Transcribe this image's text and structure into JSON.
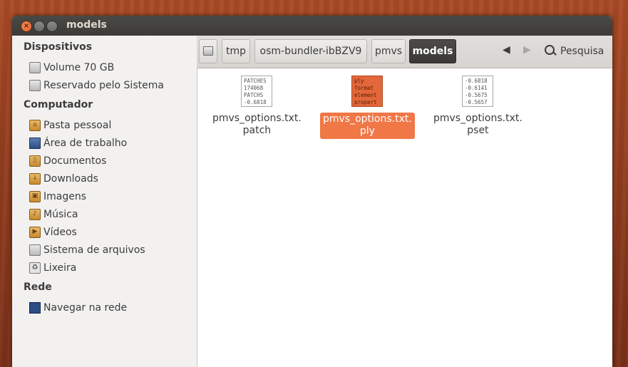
{
  "window": {
    "title": "models"
  },
  "sidebar": {
    "sections": [
      {
        "heading": "Dispositivos",
        "items": [
          {
            "label": "Volume 70 GB",
            "icon": "drive-icon"
          },
          {
            "label": "Reservado pelo Sistema",
            "icon": "drive-icon"
          }
        ]
      },
      {
        "heading": "Computador",
        "items": [
          {
            "label": "Pasta pessoal",
            "icon": "home-folder-icon"
          },
          {
            "label": "Área de trabalho",
            "icon": "desktop-icon"
          },
          {
            "label": "Documentos",
            "icon": "documents-folder-icon"
          },
          {
            "label": "Downloads",
            "icon": "downloads-folder-icon"
          },
          {
            "label": "Imagens",
            "icon": "pictures-folder-icon"
          },
          {
            "label": "Música",
            "icon": "music-folder-icon"
          },
          {
            "label": "Vídeos",
            "icon": "videos-folder-icon"
          },
          {
            "label": "Sistema de arquivos",
            "icon": "drive-icon"
          },
          {
            "label": "Lixeira",
            "icon": "trash-icon"
          }
        ]
      },
      {
        "heading": "Rede",
        "items": [
          {
            "label": "Navegar na rede",
            "icon": "network-icon"
          }
        ]
      }
    ]
  },
  "toolbar": {
    "breadcrumbs": [
      "tmp",
      "osm-bundler-ibBZV9",
      "pmvs",
      "models"
    ],
    "search_label": "Pesquisa"
  },
  "files": [
    {
      "name_line1": "pmvs_options.txt.",
      "name_line2": "patch",
      "preview": "PATCHES\n174068\nPATCHS\n-0.6818",
      "selected": false
    },
    {
      "name_line1": "pmvs_options.txt.",
      "name_line2": "ply",
      "preview": "ply\nformat\nelement\npropert",
      "selected": true
    },
    {
      "name_line1": "pmvs_options.txt.",
      "name_line2": "pset",
      "preview": "-0.6818\n-0.6141\n-0.5675\n-0.5657",
      "selected": false
    }
  ],
  "colors": {
    "selection": "#f07746",
    "titlebar": "#3c3b37"
  }
}
